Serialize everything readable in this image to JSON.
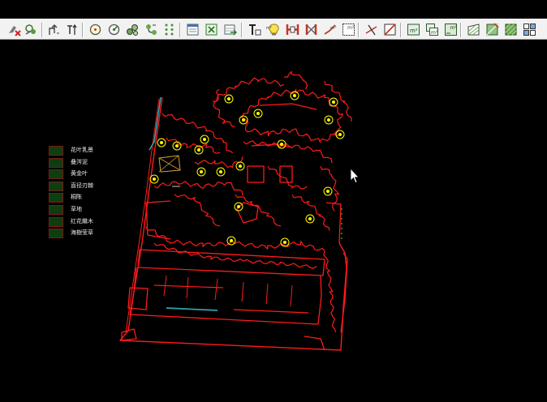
{
  "toolbar": {
    "buttons": [
      {
        "name": "erase-pipe-icon"
      },
      {
        "name": "erase-group-icon"
      },
      {
        "name": "pipe-up-icon"
      },
      {
        "name": "pipe-text-icon"
      },
      {
        "name": "sprinkler-circle-icon"
      },
      {
        "name": "sprinkler-rotate-icon"
      },
      {
        "name": "multi-sprinkler-icon"
      },
      {
        "name": "sprinkler-connect-icon"
      },
      {
        "name": "dot-grid-icon"
      },
      {
        "name": "window-table-icon"
      },
      {
        "name": "excel-export-icon"
      },
      {
        "name": "table-arrow-icon"
      },
      {
        "name": "text-style-icon"
      },
      {
        "name": "lightbulb-icon"
      },
      {
        "name": "valve-h-icon"
      },
      {
        "name": "valve-alt-icon"
      },
      {
        "name": "pipe-area-icon"
      },
      {
        "name": "area-m2-icon"
      },
      {
        "name": "trim-line-icon"
      },
      {
        "name": "cut-line-icon"
      },
      {
        "name": "area-m2-icon-b"
      },
      {
        "name": "area-m2-stack-icon"
      },
      {
        "name": "area-m2-calc-icon"
      },
      {
        "name": "hatch-edit-icon"
      },
      {
        "name": "hatch-fill-icon"
      },
      {
        "name": "hatch-pattern-icon"
      },
      {
        "name": "block-grid-icon"
      }
    ],
    "m2_label": "m²",
    "text_label": "T"
  },
  "legend": {
    "items": [
      {
        "label": "花叶乳景"
      },
      {
        "label": "叠涔泥"
      },
      {
        "label": "黄金叶"
      },
      {
        "label": "直径刃棘"
      },
      {
        "label": "桐陈"
      },
      {
        "label": "草地"
      },
      {
        "label": "红花繼木"
      },
      {
        "label": "海樹莹草"
      }
    ],
    "swatch_color": "#0e3d0e"
  },
  "drawing": {
    "background": "#000000",
    "line_color": "#ff1a1a",
    "sprinkler_color": "#ffff00",
    "pipe_color": "#2fa4a4"
  }
}
